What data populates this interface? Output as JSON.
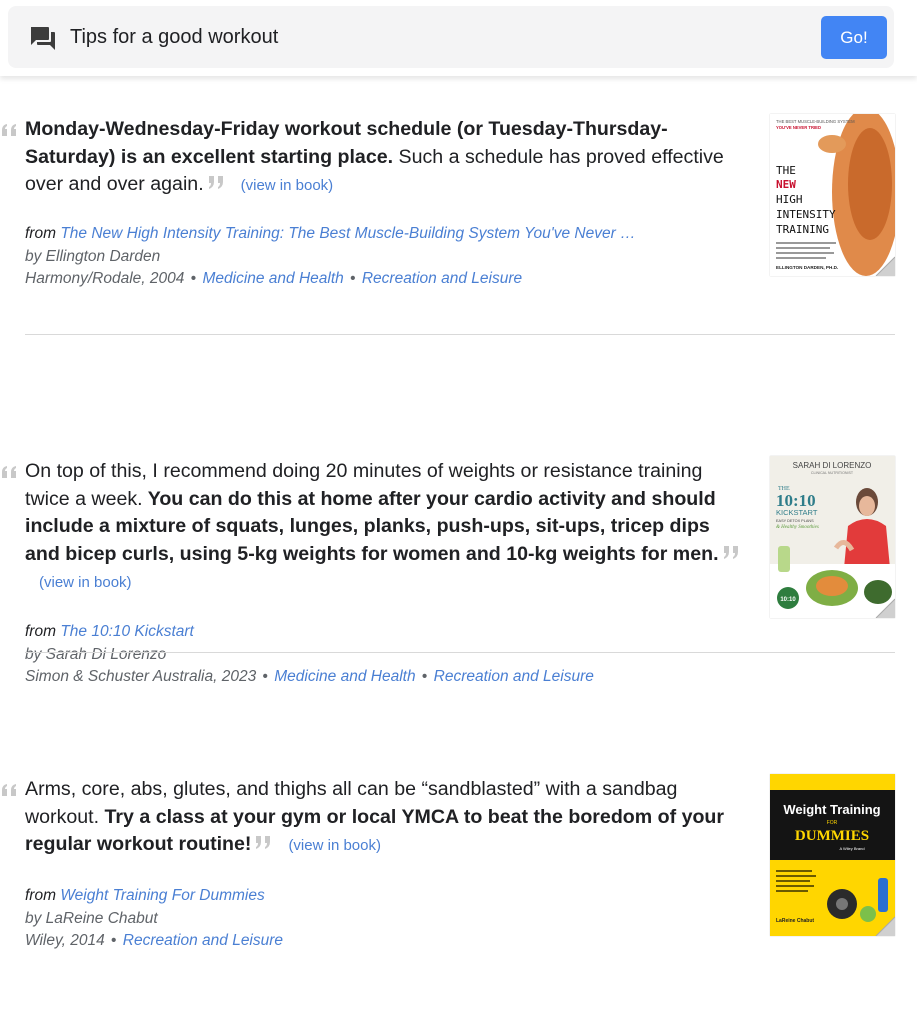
{
  "search": {
    "query": "Tips for a good workout",
    "go_label": "Go!"
  },
  "view_in_book_label": "(view in book)",
  "from_label": "from",
  "results": [
    {
      "quote_bold_1": "Monday-Wednesday-Friday workout schedule (or Tuesday-Thursday-Saturday) is an excellent starting place.",
      "quote_plain_1": " Such a schedule has proved effective over and over again.",
      "quote_bold_2": "",
      "title": "The New High Intensity Training: The Best Muscle-Building System You've Never …",
      "author": "by Ellington Darden",
      "publisher": "Harmony/Rodale, 2004",
      "categories": [
        "Medicine and Health",
        "Recreation and Leisure"
      ],
      "cover": {
        "tagline": "THE BEST MUSCLE-BUILDING SYSTEM",
        "tagline_red": "YOU'VE NEVER TRIED",
        "t1": "THE",
        "t2": "NEW",
        "t3": "HIGH",
        "t4": "INTENSITY",
        "t5": "TRAINING",
        "author": "ELLINGTON DARDEN, PH.D."
      }
    },
    {
      "quote_plain_1": "On top of this, I recommend doing 20 minutes of weights or resistance training twice a week.",
      "quote_bold_2": " You can do this at home after your cardio activity and should include a mixture of squats, lunges, planks, push-ups, sit-ups, tricep dips and bicep curls, using 5-kg weights for women and 10-kg weights for men.",
      "title": "The 10:10 Kickstart",
      "author": "by Sarah Di Lorenzo",
      "publisher": "Simon & Schuster Australia, 2023",
      "categories": [
        "Medicine and Health",
        "Recreation and Leisure"
      ],
      "cover": {
        "author": "SARAH DI LORENZO",
        "subtitle": "CLINICAL NUTRITIONIST",
        "t1": "THE",
        "t2": "10:10",
        "t3": "KICKSTART",
        "t4": "EASY DETOX PLANS",
        "t5": "& Healthy Smoothies",
        "badge": "10:10"
      }
    },
    {
      "quote_plain_1": "Arms, core, abs, glutes, and thighs all can be “sandblasted” with a sandbag workout.",
      "quote_bold_2": " Try a class at your gym or local YMCA to beat the boredom of your regular workout routine!",
      "title": "Weight Training For Dummies",
      "author": "by LaReine Chabut",
      "publisher": "Wiley, 2014",
      "categories": [
        "Recreation and Leisure"
      ],
      "cover": {
        "t1": "Weight Training",
        "t2": "FOR",
        "t3": "DUMMIES",
        "t4": "A Wiley Brand",
        "t5": "LaReine Chabut"
      }
    }
  ],
  "colors": {
    "go_button": "#4285f4",
    "link": "#4a7fd3",
    "search_bg": "#f4f4f5"
  }
}
